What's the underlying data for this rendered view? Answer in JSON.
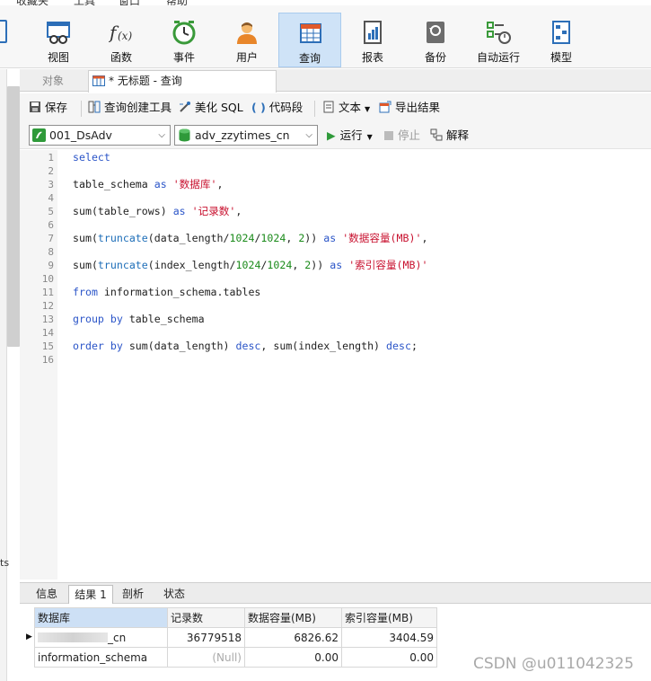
{
  "menu": {
    "items": [
      "收藏夹",
      "工具",
      "窗口",
      "帮助"
    ]
  },
  "toolbar": {
    "items": [
      {
        "label": "视图",
        "icon": "view-icon"
      },
      {
        "label": "函数",
        "icon": "function-icon"
      },
      {
        "label": "事件",
        "icon": "clock-icon"
      },
      {
        "label": "用户",
        "icon": "user-icon"
      },
      {
        "label": "查询",
        "icon": "query-table-icon",
        "active": true
      },
      {
        "label": "报表",
        "icon": "report-icon"
      },
      {
        "label": "备份",
        "icon": "backup-icon"
      },
      {
        "label": "自动运行",
        "icon": "schedule-icon"
      },
      {
        "label": "模型",
        "icon": "model-icon"
      }
    ]
  },
  "tabs": {
    "objects": "对象",
    "query": "* 无标题 - 查询"
  },
  "editor_toolbar": {
    "save": "保存",
    "query_builder": "查询创建工具",
    "beautify": "美化 SQL",
    "snippet": "代码段",
    "text": "文本",
    "export": "导出结果",
    "connection": "001_DsAdv",
    "database": "adv_zzytimes_cn",
    "run": "运行",
    "stop": "停止",
    "explain": "解释"
  },
  "sql_lines": [
    {
      "n": "1"
    },
    {
      "n": "2"
    },
    {
      "n": "3"
    },
    {
      "n": "4"
    },
    {
      "n": "5"
    },
    {
      "n": "6"
    },
    {
      "n": "7"
    },
    {
      "n": "8"
    },
    {
      "n": "9"
    },
    {
      "n": "10"
    },
    {
      "n": "11"
    },
    {
      "n": "12"
    },
    {
      "n": "13"
    },
    {
      "n": "14"
    },
    {
      "n": "15"
    },
    {
      "n": "16"
    }
  ],
  "sql": {
    "l1": [
      [
        "kw",
        "select"
      ]
    ],
    "l3": [
      [
        "plain",
        "table_schema "
      ],
      [
        "kw",
        "as"
      ],
      [
        "plain",
        " "
      ],
      [
        "str",
        "'数据库'"
      ],
      [
        "plain",
        ","
      ]
    ],
    "l5": [
      [
        "plain",
        "sum(table_rows) "
      ],
      [
        "kw",
        "as"
      ],
      [
        "plain",
        " "
      ],
      [
        "str",
        "'记录数'"
      ],
      [
        "plain",
        ","
      ]
    ],
    "l7": [
      [
        "plain",
        "sum("
      ],
      [
        "fn",
        "truncate"
      ],
      [
        "plain",
        "(data_length/"
      ],
      [
        "num",
        "1024"
      ],
      [
        "plain",
        "/"
      ],
      [
        "num",
        "1024"
      ],
      [
        "plain",
        ", "
      ],
      [
        "num",
        "2"
      ],
      [
        "plain",
        ")) "
      ],
      [
        "kw",
        "as"
      ],
      [
        "plain",
        " "
      ],
      [
        "str",
        "'数据容量(MB)'"
      ],
      [
        "plain",
        ","
      ]
    ],
    "l9": [
      [
        "plain",
        "sum("
      ],
      [
        "fn",
        "truncate"
      ],
      [
        "plain",
        "(index_length/"
      ],
      [
        "num",
        "1024"
      ],
      [
        "plain",
        "/"
      ],
      [
        "num",
        "1024"
      ],
      [
        "plain",
        ", "
      ],
      [
        "num",
        "2"
      ],
      [
        "plain",
        ")) "
      ],
      [
        "kw",
        "as"
      ],
      [
        "plain",
        " "
      ],
      [
        "str",
        "'索引容量(MB)'"
      ]
    ],
    "l11": [
      [
        "kw",
        "from"
      ],
      [
        "plain",
        " information_schema.tables"
      ]
    ],
    "l13": [
      [
        "kw",
        "group by"
      ],
      [
        "plain",
        " table_schema"
      ]
    ],
    "l15": [
      [
        "kw",
        "order by"
      ],
      [
        "plain",
        " sum(data_length) "
      ],
      [
        "kw",
        "desc"
      ],
      [
        "plain",
        ", sum(index_length) "
      ],
      [
        "kw",
        "desc"
      ],
      [
        "plain",
        ";"
      ]
    ]
  },
  "result_tabs": {
    "info": "信息",
    "result1": "结果 1",
    "profile": "剖析",
    "status": "状态"
  },
  "grid": {
    "headers": [
      "数据库",
      "记录数",
      "数据容量(MB)",
      "索引容量(MB)"
    ],
    "rows": [
      {
        "db_suffix": "_cn",
        "records": "36779518",
        "data": "6826.62",
        "index": "3404.59"
      },
      {
        "db": "information_schema",
        "records": "(Null)",
        "data": "0.00",
        "index": "0.00"
      }
    ]
  },
  "left_text": "ts",
  "watermark": "CSDN @u011042325"
}
